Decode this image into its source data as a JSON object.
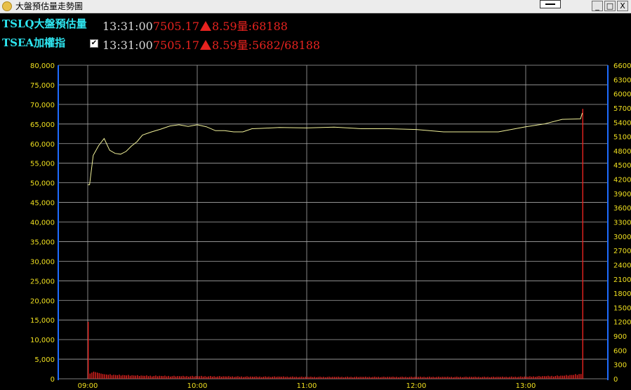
{
  "window": {
    "title": "大盤預估量走勢圖",
    "controls": {
      "minimize": "_",
      "maximize": "□",
      "close": "X"
    }
  },
  "header": {
    "rows": [
      {
        "name": "TSLQ大盤預估量",
        "time": "13:31:00",
        "price": "7505.17",
        "change": "8.59",
        "volume_text": "量:68188",
        "checkbox": false
      },
      {
        "name": "TSEA加權指",
        "time": "13:31:00",
        "price": "7505.17",
        "change": "8.59",
        "volume_text": "量:5682/68188",
        "checkbox": true
      }
    ]
  },
  "colors": {
    "background": "#000000",
    "grid": "#a8a8a8",
    "axis": "#1e6cff",
    "tick_label": "#f0e020",
    "line": "#f2f29a",
    "volume": "#e8231f",
    "header_name": "#2ee6f0",
    "header_red": "#e8231f"
  },
  "chart_data": {
    "type": "line",
    "title": "",
    "xlabel": "",
    "ylabel": "",
    "x_ticks": [
      "09:00",
      "10:00",
      "11:00",
      "12:00",
      "13:00"
    ],
    "x_range": [
      "09:00",
      "13:31"
    ],
    "grid": true,
    "y_left": {
      "ticks": [
        "0",
        "5,000",
        "10,000",
        "15,000",
        "20,000",
        "25,000",
        "30,000",
        "35,000",
        "40,000",
        "45,000",
        "50,000",
        "55,000",
        "60,000",
        "65,000",
        "70,000",
        "75,000",
        "80,000"
      ],
      "ylim": [
        0,
        80000
      ]
    },
    "y_right": {
      "ticks": [
        "0",
        "300",
        "600",
        "900",
        "1200",
        "1500",
        "1800",
        "2100",
        "2400",
        "2700",
        "3000",
        "3300",
        "3600",
        "3900",
        "4200",
        "4500",
        "4800",
        "5100",
        "5400",
        "5700",
        "6000",
        "6300",
        "6600"
      ],
      "ylim": [
        0,
        6600
      ]
    },
    "series": [
      {
        "axis": "left",
        "kind": "line",
        "x": [
          "09:00",
          "09:01",
          "09:03",
          "09:06",
          "09:09",
          "09:12",
          "09:15",
          "09:18",
          "09:21",
          "09:24",
          "09:27",
          "09:30",
          "09:35",
          "09:40",
          "09:45",
          "09:50",
          "09:55",
          "10:00",
          "10:05",
          "10:10",
          "10:15",
          "10:20",
          "10:25",
          "10:30",
          "10:35",
          "10:45",
          "11:00",
          "11:15",
          "11:30",
          "11:45",
          "12:00",
          "12:15",
          "12:30",
          "12:45",
          "13:00",
          "13:10",
          "13:20",
          "13:30",
          "13:31"
        ],
        "y": [
          49500,
          49500,
          57000,
          59500,
          61300,
          58300,
          57500,
          57300,
          58000,
          59400,
          60500,
          62200,
          63000,
          63700,
          64500,
          64800,
          64400,
          64800,
          64300,
          63300,
          63300,
          63000,
          63000,
          63800,
          63900,
          64100,
          64000,
          64200,
          63800,
          63800,
          63600,
          63000,
          63000,
          63000,
          64300,
          65000,
          66200,
          66300,
          67800
        ]
      },
      {
        "axis": "right",
        "kind": "bar",
        "x": [
          "09:00",
          "09:01",
          "09:02",
          "09:03",
          "09:04",
          "09:05",
          "09:06",
          "09:07",
          "09:08",
          "09:09",
          "09:10",
          "09:15",
          "09:20",
          "09:25",
          "09:30",
          "09:40",
          "09:50",
          "10:00",
          "10:15",
          "10:30",
          "10:45",
          "11:00",
          "11:15",
          "11:30",
          "11:45",
          "12:00",
          "12:15",
          "12:30",
          "12:45",
          "13:00",
          "13:10",
          "13:20",
          "13:25",
          "13:30",
          "13:31"
        ],
        "y": [
          1200,
          110,
          130,
          150,
          140,
          130,
          120,
          110,
          100,
          95,
          90,
          80,
          75,
          70,
          65,
          60,
          55,
          55,
          50,
          45,
          45,
          40,
          40,
          40,
          40,
          40,
          40,
          40,
          40,
          45,
          55,
          65,
          80,
          100,
          5682
        ]
      }
    ]
  }
}
